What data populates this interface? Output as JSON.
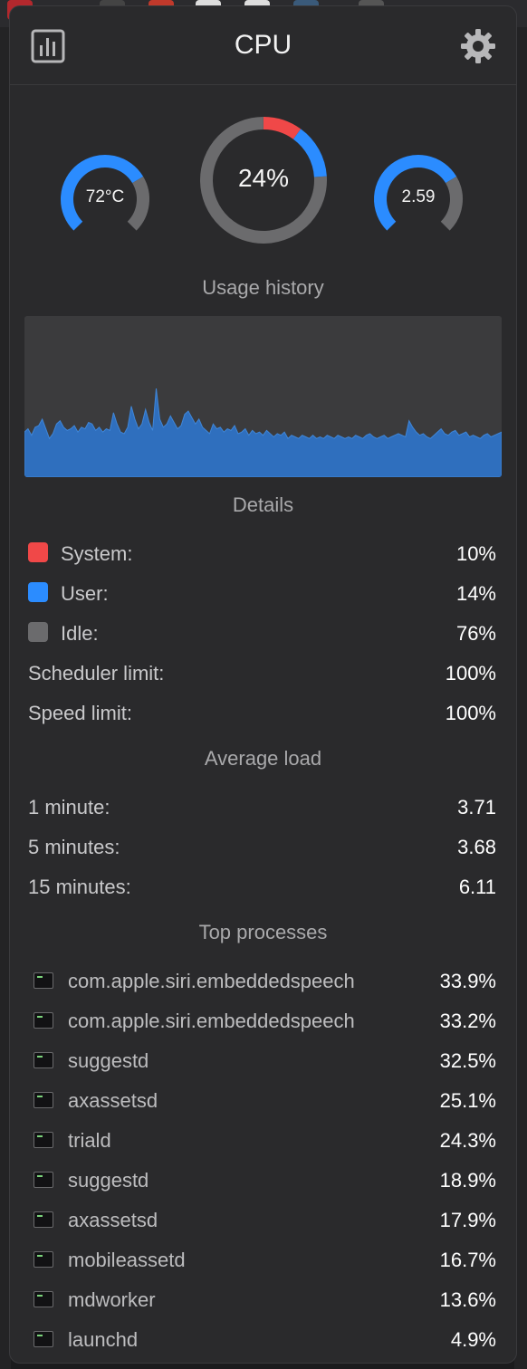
{
  "header": {
    "title": "CPU",
    "left_icon": "bar-chart-icon",
    "right_icon": "gear-icon"
  },
  "gauges": {
    "temperature": {
      "text": "72°C",
      "fraction": 0.72
    },
    "usage": {
      "text": "24%",
      "system_fraction": 0.1,
      "user_fraction": 0.14
    },
    "load": {
      "text": "2.59",
      "fraction": 0.72
    }
  },
  "colors": {
    "system": "#f04848",
    "user": "#2b8cff",
    "idle": "#6b6b6d",
    "history_fill": "#2f6fbe"
  },
  "usage_history": {
    "title": "Usage history",
    "values": [
      28,
      30,
      26,
      31,
      32,
      36,
      30,
      24,
      27,
      33,
      35,
      31,
      29,
      30,
      32,
      28,
      31,
      30,
      34,
      33,
      29,
      31,
      28,
      30,
      29,
      40,
      33,
      28,
      27,
      31,
      44,
      36,
      30,
      33,
      42,
      34,
      29,
      55,
      36,
      31,
      33,
      38,
      34,
      30,
      32,
      39,
      41,
      37,
      33,
      36,
      31,
      29,
      27,
      33,
      30,
      31,
      28,
      30,
      29,
      32,
      27,
      28,
      30,
      26,
      29,
      27,
      28,
      26,
      29,
      27,
      25,
      27,
      26,
      28,
      24,
      26,
      25,
      24,
      26,
      25,
      24,
      26,
      24,
      25,
      24,
      26,
      25,
      24,
      26,
      25,
      24,
      25,
      24,
      26,
      25,
      24,
      26,
      27,
      25,
      24,
      25,
      26,
      24,
      25,
      26,
      27,
      26,
      25,
      35,
      31,
      28,
      26,
      27,
      25,
      24,
      26,
      28,
      30,
      27,
      26,
      28,
      29,
      26,
      27,
      28,
      25,
      26,
      25,
      24,
      26,
      27,
      25,
      26,
      27,
      28
    ]
  },
  "details": {
    "title": "Details",
    "rows": [
      {
        "label": "System:",
        "value": "10%"
      },
      {
        "label": "User:",
        "value": "14%"
      },
      {
        "label": "Idle:",
        "value": "76%"
      },
      {
        "label": "Scheduler limit:",
        "value": "100%"
      },
      {
        "label": "Speed limit:",
        "value": "100%"
      }
    ]
  },
  "average_load": {
    "title": "Average load",
    "rows": [
      {
        "label": "1 minute:",
        "value": "3.71"
      },
      {
        "label": "5 minutes:",
        "value": "3.68"
      },
      {
        "label": "15 minutes:",
        "value": "6.11"
      }
    ]
  },
  "top_processes": {
    "title": "Top processes",
    "icon": "terminal-icon",
    "rows": [
      {
        "name": "com.apple.siri.embeddedspeech",
        "value": "33.9%"
      },
      {
        "name": "com.apple.siri.embeddedspeech",
        "value": "33.2%"
      },
      {
        "name": "suggestd",
        "value": "32.5%"
      },
      {
        "name": "axassetsd",
        "value": "25.1%"
      },
      {
        "name": "triald",
        "value": "24.3%"
      },
      {
        "name": "suggestd",
        "value": "18.9%"
      },
      {
        "name": "axassetsd",
        "value": "17.9%"
      },
      {
        "name": "mobileassetd",
        "value": "16.7%"
      },
      {
        "name": "mdworker",
        "value": "13.6%"
      },
      {
        "name": "launchd",
        "value": "4.9%"
      }
    ]
  }
}
